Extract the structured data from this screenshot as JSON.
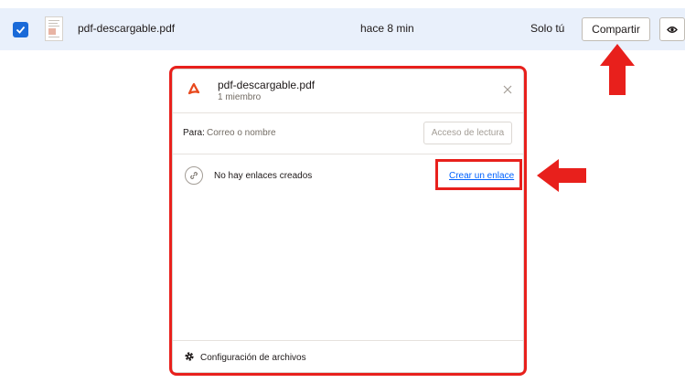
{
  "file_row": {
    "file_name": "pdf-descargable.pdf",
    "modified": "hace 8 min",
    "members": "Solo tú",
    "share_label": "Compartir",
    "checked": true
  },
  "share_panel": {
    "title": "pdf-descargable.pdf",
    "subtitle": "1 miembro",
    "to_label": "Para:",
    "to_placeholder": "Correo o nombre",
    "access_label": "Acceso de lectura",
    "no_links_text": "No hay enlaces creados",
    "create_link_label": "Crear un enlace",
    "settings_label": "Configuración de archivos"
  },
  "icons": {
    "checkbox": "check-icon",
    "file_thumbnail": "pdf-thumbnail",
    "preview": "eye-icon",
    "file_type": "pdf-icon",
    "close": "close-icon",
    "link": "link-icon",
    "settings": "gear-icon"
  },
  "colors": {
    "selected_row": "#e9f0fb",
    "accent": "#0061fe",
    "checkbox": "#1a6ad8",
    "annotation": "#e8201c",
    "pdf_icon": "#e8481c"
  }
}
